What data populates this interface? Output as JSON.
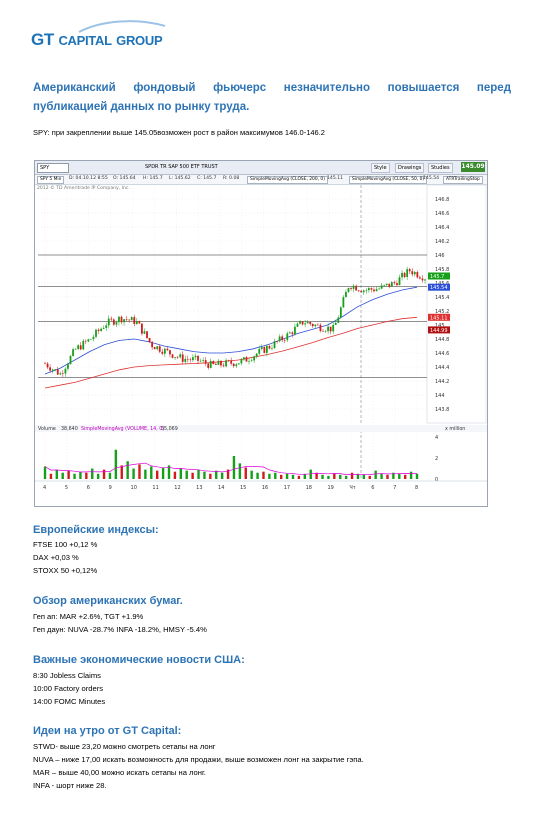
{
  "logo": {
    "text_gt": "GT",
    "text_capital": "Capital",
    "text_group": "Group"
  },
  "headline": "Американский фондовый фьючерс незначительно повышается перед публикацией данных по рынку труда.",
  "spy_note": "SPY:  при закреплении выше 145.05возможен рост в район максимумов 146.0-146.2",
  "chart_window": {
    "symbol": "SPY",
    "description": "SPDR TR SAP 500 ETF TRUST",
    "buttons": [
      "Style",
      "Drawings",
      "Studies"
    ],
    "last_price": "145.09",
    "info_bar": {
      "interval": "SPY 5 Min",
      "date": "D: 04.10.12 8:55",
      "open": "O: 145.64",
      "high": "H: 145.7",
      "low": "L: 145.62",
      "close": "C: 145.7",
      "change": "R: 0.08",
      "sma200_label": "SimpleMovingAvg (CLOSE, 200, 0)",
      "sma200_value": "145.11",
      "sma50_label": "SimpleMovingAvg (CLOSE, 50, 0)",
      "sma50_value": "145.54",
      "atr_label": "ATRTrailingStop"
    },
    "copyright": "2012 © TD Ameritrade IP Company, Inc.",
    "volume_bar": {
      "label": "Volume",
      "value": "38,640",
      "avg_label": "SimpleMovingAvg (VOLUME, 14, 0)",
      "avg_value": "55,069",
      "unit": "x million"
    },
    "colors": {
      "up": "#16a01a",
      "down": "#d01c1c",
      "sma200": "#e03030",
      "sma50": "#2b4fd8",
      "atr": "#e000e0",
      "price_badge": "#3c8a2e"
    }
  },
  "chart_data": {
    "type": "candlestick",
    "ylim": [
      143.6,
      147.0
    ],
    "yticks": [
      "146.8",
      "146.6",
      "146.4",
      "146.2",
      "146",
      "145.8",
      "145.6",
      "145.4",
      "145.2",
      "145",
      "144.8",
      "144.6",
      "144.4",
      "144.2",
      "144",
      "143.8"
    ],
    "xticks": [
      "4",
      "5",
      "6",
      "9",
      "10",
      "11",
      "12",
      "13",
      "14",
      "15",
      "16",
      "17",
      "18",
      "19",
      "Чт",
      "6",
      "7",
      "8"
    ],
    "badges": [
      {
        "label": "145.7",
        "value": 145.7,
        "color": "#16a01a"
      },
      {
        "label": "145.54",
        "value": 145.54,
        "color": "#2b4fd8"
      },
      {
        "label": "145.11",
        "value": 145.11,
        "color": "#e03030"
      },
      {
        "label": "144.99",
        "value": 144.93,
        "color": "#b01010"
      }
    ],
    "levels": [
      146.0,
      145.55,
      145.05,
      144.25
    ],
    "price_path": [
      144.45,
      144.3,
      144.65,
      144.8,
      145.02,
      145.1,
      145.05,
      144.72,
      144.62,
      144.52,
      144.5,
      144.42,
      144.45,
      144.48,
      144.6,
      144.72,
      144.86,
      145.05,
      144.98,
      144.94,
      145.58,
      145.5,
      145.52,
      145.6,
      145.78,
      145.68
    ],
    "sma50_path": [
      144.3,
      144.38,
      144.5,
      144.62,
      144.72,
      144.78,
      144.8,
      144.76,
      144.7,
      144.66,
      144.62,
      144.6,
      144.6,
      144.62,
      144.66,
      144.72,
      144.8,
      144.88,
      144.94,
      145.0,
      145.12,
      145.26,
      145.36,
      145.44,
      145.5,
      145.54
    ],
    "sma200_path": [
      144.1,
      144.14,
      144.18,
      144.24,
      144.3,
      144.36,
      144.4,
      144.42,
      144.43,
      144.44,
      144.45,
      144.46,
      144.48,
      144.5,
      144.54,
      144.58,
      144.63,
      144.69,
      144.75,
      144.82,
      144.88,
      144.95,
      145.0,
      145.05,
      145.09,
      145.11
    ],
    "volume_ticks": [
      "4",
      "2",
      "0"
    ],
    "volume": [
      1.2,
      0.5,
      0.9,
      0.6,
      0.8,
      0.5,
      0.7,
      0.6,
      1.0,
      0.5,
      0.9,
      0.6,
      2.8,
      1.3,
      1.7,
      1.0,
      1.4,
      0.9,
      1.2,
      0.8,
      1.1,
      1.3,
      0.7,
      1.0,
      0.8,
      0.6,
      0.9,
      0.7,
      0.5,
      0.8,
      0.6,
      0.9,
      2.2,
      1.5,
      1.1,
      0.8,
      0.6,
      0.7,
      0.5,
      0.6,
      0.4,
      0.5,
      0.4,
      0.3,
      0.5,
      0.9,
      0.6,
      0.4,
      0.3,
      0.5,
      0.4,
      0.3,
      0.6,
      0.5,
      0.4,
      0.3,
      0.8,
      0.5,
      0.4,
      0.6,
      0.5,
      0.4,
      0.7,
      0.5
    ]
  },
  "sections": {
    "europe": {
      "title": "Европейские индексы:",
      "lines": [
        "FTSE 100 +0,12 %",
        "DAX +0,03 %",
        "STOXX 50 +0,12%"
      ]
    },
    "us_stocks": {
      "title": "Обзор американских бумаг.",
      "lines": [
        "Геп ап: MAR +2.6%, TGT +1.9%",
        "Геп даун: NUVA -28.7% INFA -18.2%, HMSY -5.4%"
      ]
    },
    "us_news": {
      "title": "Важные экономические новости США:",
      "lines": [
        "8:30 Jobless Claims",
        "10:00 Factory orders",
        "14:00 FOMC Minutes"
      ]
    },
    "ideas": {
      "title": "Идеи на утро от GT Capital:",
      "lines": [
        "STWD- выше 23,20 можно смотреть сетапы на лонг",
        "NUVA – ниже 17,00 искать возможность для продажи, выше возможен лонг на закрытие гэпа.",
        "MAR – выше 40,00 можно искать сетапы на лонг.",
        "INFA - шорт ниже 28."
      ]
    }
  }
}
